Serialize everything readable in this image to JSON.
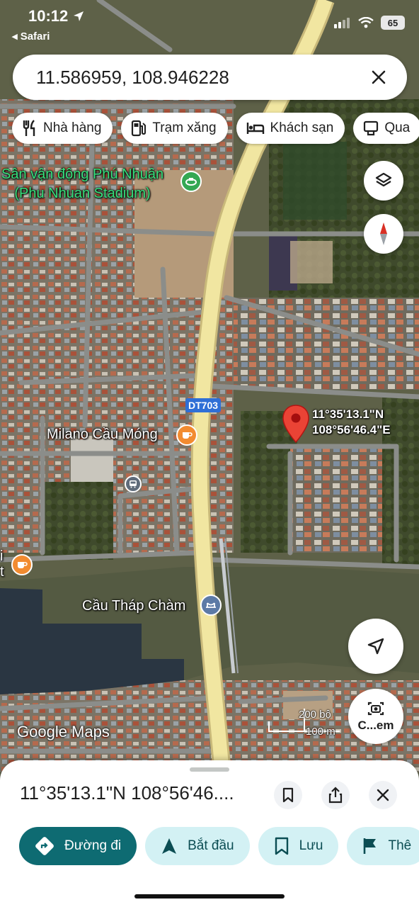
{
  "status_bar": {
    "time": "10:12",
    "back_app": "◂ Safari",
    "battery": "65"
  },
  "search": {
    "query": "11.586959, 108.946228"
  },
  "chips": [
    {
      "label": "Nhà hàng",
      "icon": "restaurant-icon"
    },
    {
      "label": "Trạm xăng",
      "icon": "gas-station-icon"
    },
    {
      "label": "Khách sạn",
      "icon": "hotel-icon"
    },
    {
      "label": "Qua",
      "icon": "shopping-icon"
    }
  ],
  "map": {
    "stadium_name": "Sân vận động Phú Nhuận",
    "stadium_name_en": "(Phu Nhuan Stadium)",
    "road_label": "DT703",
    "cafe_name": "Milano Cầu Móng",
    "left_edge_label_1": "i",
    "left_edge_label_2": "t",
    "bridge_name": "Cầu Tháp Chàm",
    "pin_lat": "11°35'13.1\"N",
    "pin_lon": "108°56'46.4\"E",
    "scale_imperial": "200 bộ",
    "scale_metric": "100 m",
    "google_logo": "Google Maps",
    "camera_button_label": "C...em",
    "colors": {
      "pin": "#ea4335",
      "road": "#f1e6a1",
      "poi_green": "#34a853",
      "poi_orange": "#f28b30"
    }
  },
  "sheet": {
    "title": "11°35'13.1\"N 108°56'46....",
    "actions": [
      {
        "label": "Đường đi",
        "icon": "directions-icon",
        "style": "primary"
      },
      {
        "label": "Bắt đầu",
        "icon": "navigation-icon",
        "style": "secondary"
      },
      {
        "label": "Lưu",
        "icon": "bookmark-icon",
        "style": "secondary"
      },
      {
        "label": "Thê",
        "icon": "flag-icon",
        "style": "secondary"
      }
    ],
    "colors": {
      "primary": "#0e6b72",
      "secondary": "#d3f1f4"
    }
  }
}
